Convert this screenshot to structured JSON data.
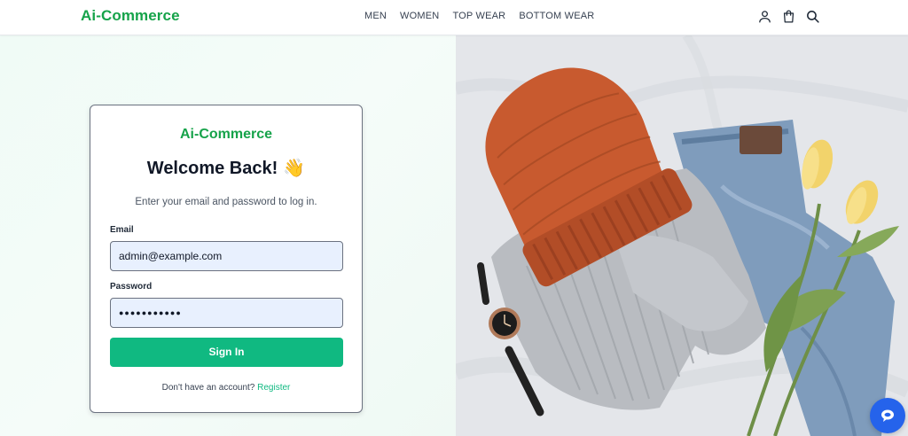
{
  "header": {
    "logo": "Ai-Commerce",
    "nav": [
      "MEN",
      "WOMEN",
      "TOP WEAR",
      "BOTTOM WEAR"
    ],
    "icons": [
      "user-icon",
      "shopping-bag-icon",
      "search-icon"
    ]
  },
  "login": {
    "brand": "Ai-Commerce",
    "title": "Welcome Back!",
    "title_emoji": "👋",
    "subtitle": "Enter your email and password to log in.",
    "email_label": "Email",
    "email_value": "admin@example.com",
    "password_label": "Password",
    "password_value": "●●●●●●●●●●●",
    "submit_label": "Sign In",
    "register_prompt": "Don't have an account?",
    "register_link": "Register"
  },
  "colors": {
    "brand": "#16a34a",
    "button": "#10b981",
    "input_bg": "#e8f0fe",
    "chat_button": "#2563eb"
  },
  "image": {
    "subject": "flat-lay of orange knit beanie, grey sweater, jeans, wristwatch and yellow tulips"
  }
}
